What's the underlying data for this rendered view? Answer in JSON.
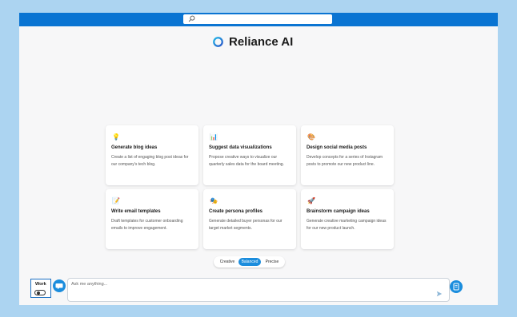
{
  "app": {
    "name": "Reliance AI"
  },
  "search": {
    "placeholder": ""
  },
  "cards": [
    {
      "icon": "lightbulb-icon",
      "emoji": "💡",
      "title": "Generate blog ideas",
      "desc": "Create a list of engaging blog post ideas for our company's tech blog."
    },
    {
      "icon": "bar-chart-icon",
      "emoji": "📊",
      "title": "Suggest data visualizations",
      "desc": "Propose creative ways to visualize our quarterly sales data for the board meeting."
    },
    {
      "icon": "palette-icon",
      "emoji": "🎨",
      "title": "Design social media posts",
      "desc": "Develop concepts for a series of Instagram posts to promote our new product line."
    },
    {
      "icon": "memo-icon",
      "emoji": "📝",
      "title": "Write email templates",
      "desc": "Draft templates for customer onboarding emails to improve engagement."
    },
    {
      "icon": "theater-masks-icon",
      "emoji": "🎭",
      "title": "Create persona profiles",
      "desc": "Generate detailed buyer personas for our target market segments."
    },
    {
      "icon": "rocket-icon",
      "emoji": "🚀",
      "title": "Brainstorm campaign ideas",
      "desc": "Generate creative marketing campaign ideas for our new product launch."
    }
  ],
  "modes": {
    "creative": "Creative",
    "balanced": "Balanced",
    "precise": "Precise",
    "selected": "Balanced"
  },
  "work": {
    "label": "Work",
    "enabled": false
  },
  "chat": {
    "placeholder": "Ask me anything..."
  },
  "colors": {
    "accent": "#1b8ddd",
    "topbar": "#0a74d2",
    "frame": "#acd4f1"
  }
}
